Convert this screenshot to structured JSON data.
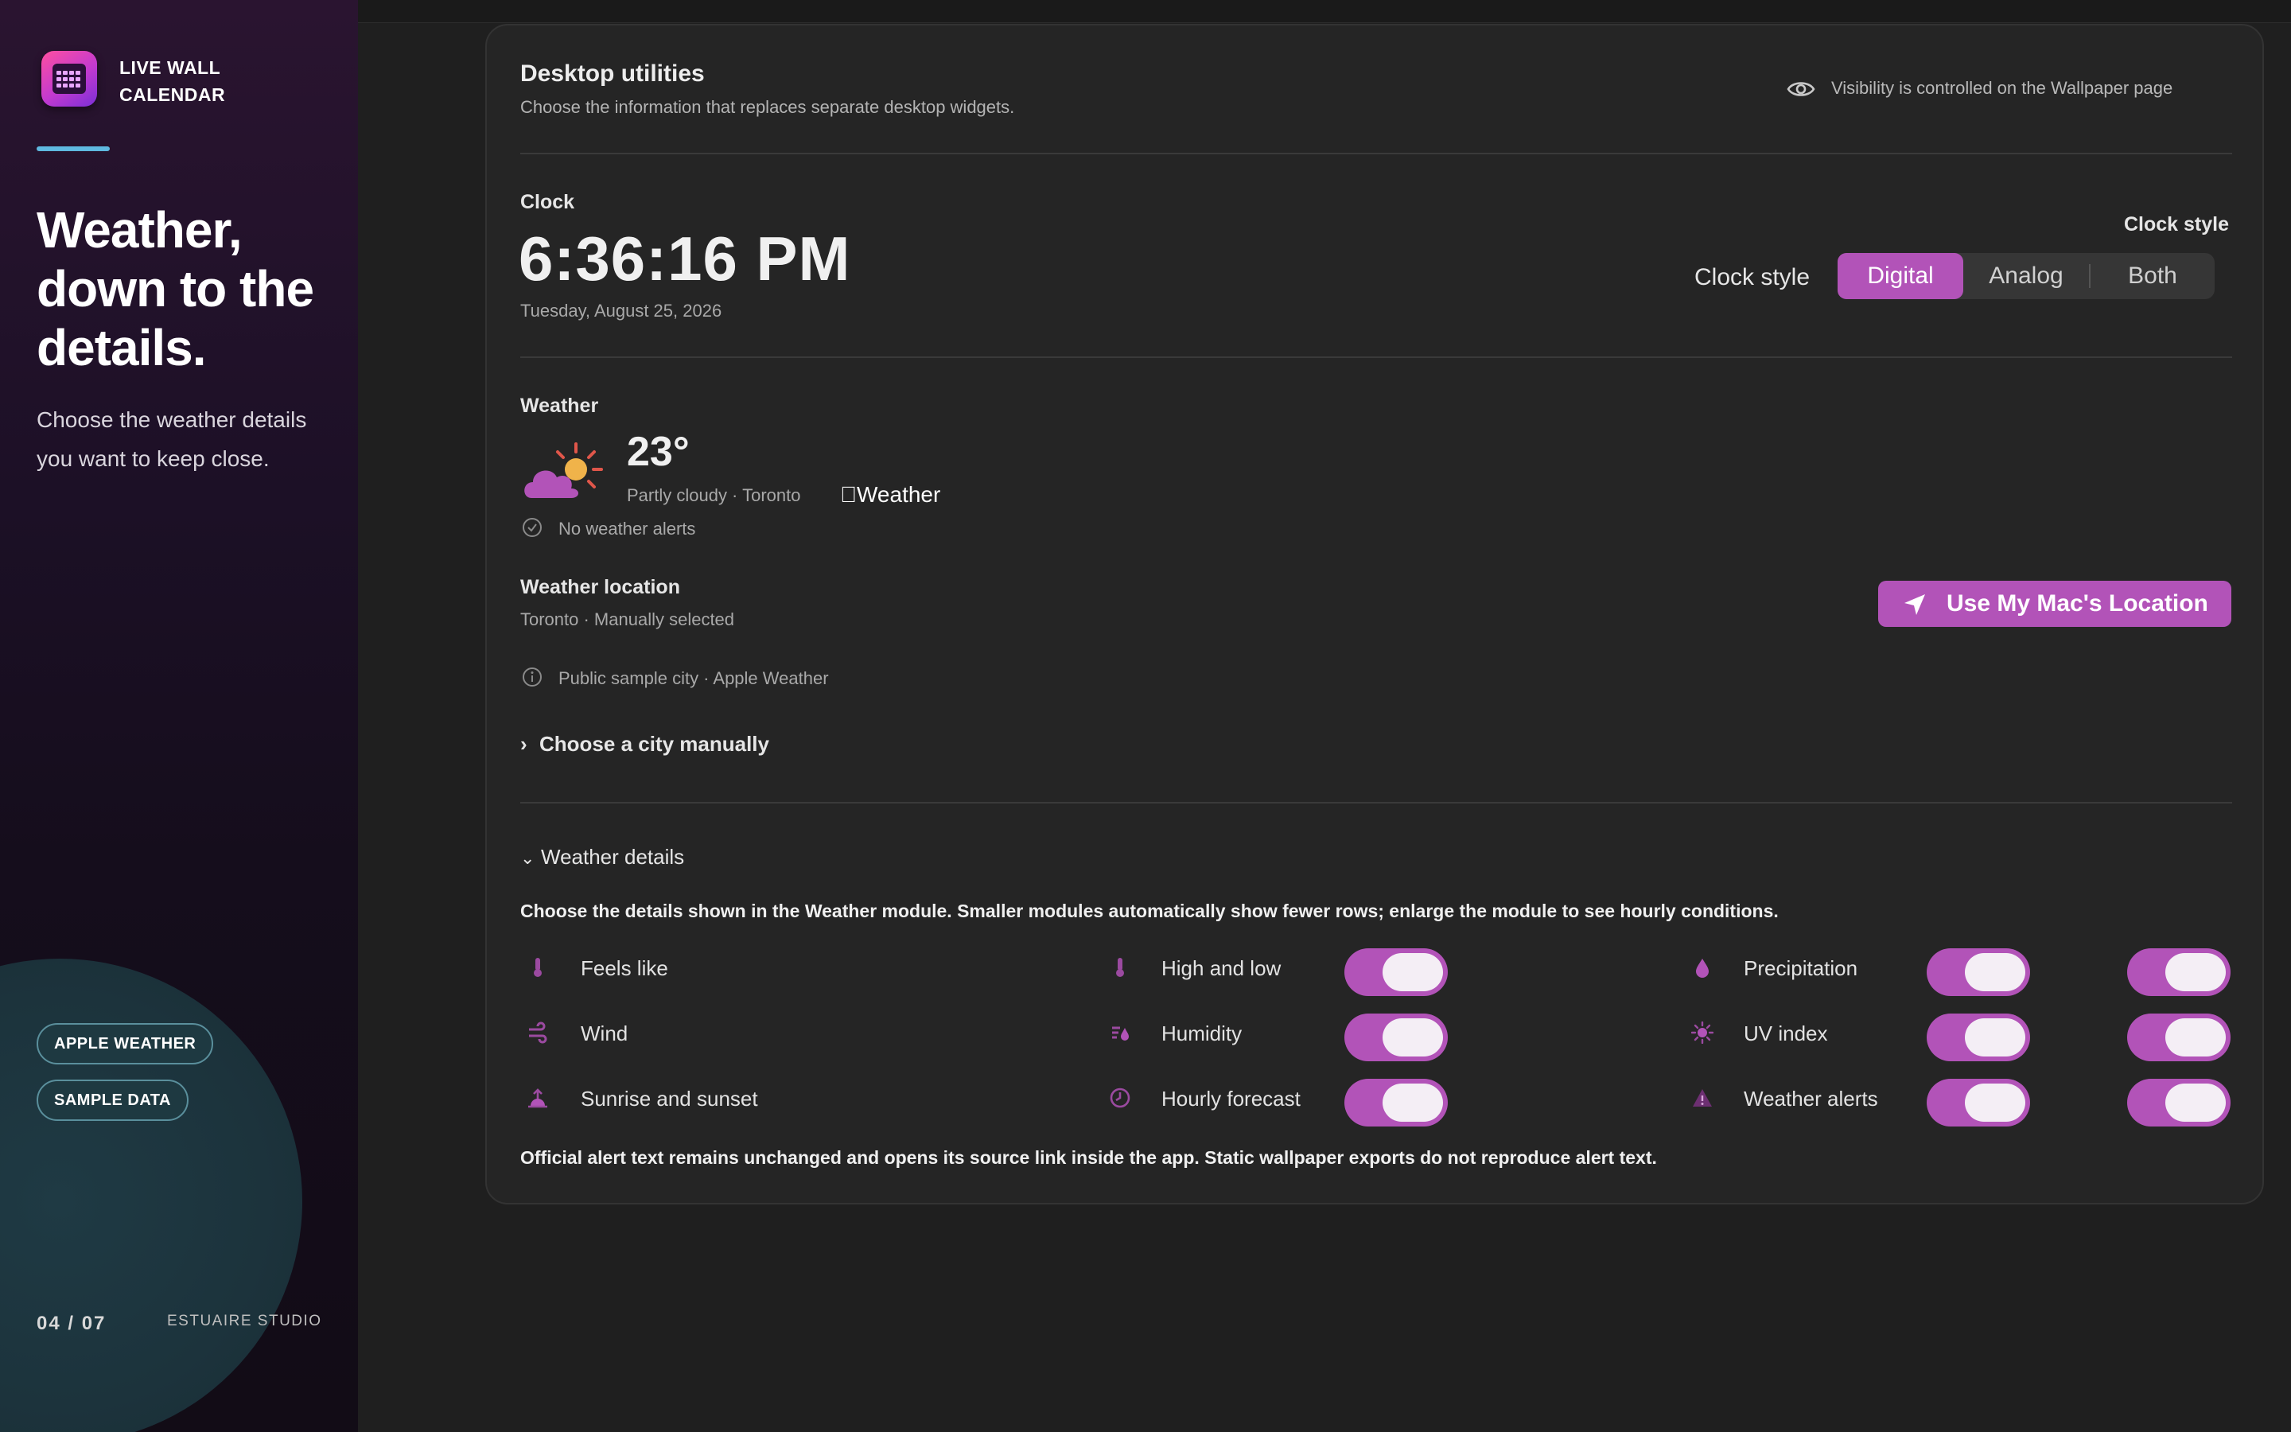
{
  "app": {
    "name_line1": "LIVE WALL",
    "name_line2": "CALENDAR"
  },
  "promo": {
    "headline": "Weather, down to the details.",
    "subcopy": "Choose the weather details you want to keep close.",
    "badges": [
      "APPLE WEATHER",
      "SAMPLE DATA"
    ],
    "page": "04 / 07",
    "studio": "ESTUAIRE STUDIO"
  },
  "utilities": {
    "title": "Desktop utilities",
    "subtitle": "Choose the information that replaces separate desktop widgets.",
    "visibility_note": "Visibility is controlled on the Wallpaper page"
  },
  "clock": {
    "heading": "Clock",
    "time": "6:36:16 PM",
    "date": "Tuesday, August 25, 2026",
    "style_heading": "Clock style",
    "style_label": "Clock style",
    "options": [
      "Digital",
      "Analog",
      "Both"
    ],
    "selected": "Digital"
  },
  "weather": {
    "heading": "Weather",
    "temperature": "23°",
    "condition_line": "Partly cloudy · Toronto",
    "provider": "Weather",
    "alerts_status": "No weather alerts",
    "location_heading": "Weather location",
    "location_value": "Toronto · Manually selected",
    "location_button": "Use My Mac's Location",
    "sample_note": "Public sample city · Apple Weather",
    "choose_city": "Choose a city manually"
  },
  "details": {
    "heading": "Weather details",
    "description": "Choose the details shown in the Weather module. Smaller modules automatically show fewer rows; enlarge the module to see hourly conditions.",
    "items": [
      {
        "label": "Feels like",
        "icon": "thermometer-icon",
        "enabled": true
      },
      {
        "label": "High and low",
        "icon": "thermometer-icon",
        "enabled": true
      },
      {
        "label": "Precipitation",
        "icon": "drop-icon",
        "enabled": true
      },
      {
        "label": "Wind",
        "icon": "wind-icon",
        "enabled": true
      },
      {
        "label": "Humidity",
        "icon": "humidity-icon",
        "enabled": true
      },
      {
        "label": "UV index",
        "icon": "sun-icon",
        "enabled": true
      },
      {
        "label": "Sunrise and sunset",
        "icon": "sunrise-icon",
        "enabled": true
      },
      {
        "label": "Hourly forecast",
        "icon": "clock-icon",
        "enabled": true
      },
      {
        "label": "Weather alerts",
        "icon": "warning-icon",
        "enabled": true
      }
    ],
    "footer": "Official alert text remains unchanged and opens its source link inside the app. Static wallpaper exports do not reproduce alert text."
  },
  "colors": {
    "accent": "#b253b8",
    "teal_line": "#5fb9e0",
    "card": "#252525"
  }
}
